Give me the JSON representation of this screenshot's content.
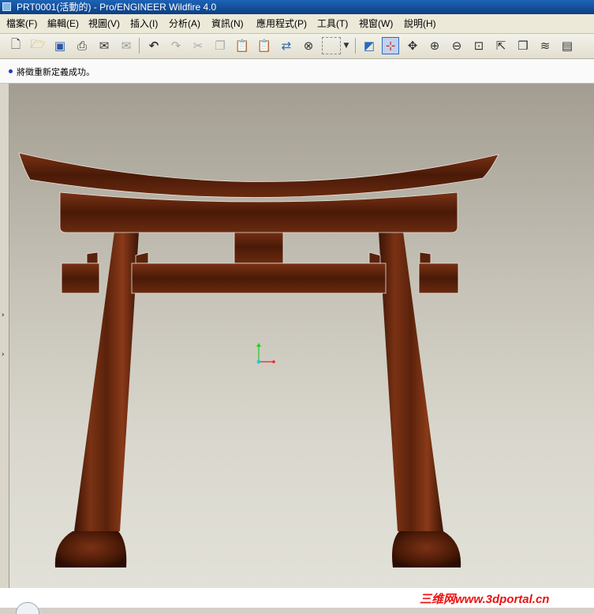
{
  "window": {
    "title": "PRT0001(活動的) - Pro/ENGINEER Wildfire 4.0"
  },
  "menu": {
    "items": [
      "檔案(F)",
      "編輯(E)",
      "視圖(V)",
      "插入(I)",
      "分析(A)",
      "資訊(N)",
      "應用程式(P)",
      "工具(T)",
      "視窗(W)",
      "說明(H)"
    ]
  },
  "toolbar": {
    "icons": [
      "new-file-icon",
      "open-folder-icon",
      "save-icon",
      "print-icon",
      "send-mail-icon",
      "mail-disabled-icon",
      "undo-icon",
      "redo-icon",
      "cut-icon",
      "copy-icon",
      "paste-icon",
      "paste-special-icon",
      "regenerate-icon",
      "find-icon",
      "selection-box-icon",
      "dropdown-icon",
      "repaint-icon",
      "spin-center-icon",
      "orient-mode-icon",
      "zoom-in-icon",
      "zoom-out-icon",
      "refit-icon",
      "reorient-icon",
      "saved-views-icon",
      "layers-icon",
      "view-manager-icon"
    ],
    "active": "spin-center-icon"
  },
  "message_area": {
    "message": "將徵重新定義成功。"
  },
  "footer": {
    "watermark": "三维网www.3dportal.cn"
  },
  "colors": {
    "title_bar": "#0d3f82",
    "wood_dark": "#3a1405",
    "wood_mid": "#6a2a10",
    "wood_light": "#8a3a18",
    "csys_green": "#22cc22",
    "csys_red": "#ee2222",
    "csys_cyan": "#22cccc",
    "watermark": "#ee1111"
  }
}
